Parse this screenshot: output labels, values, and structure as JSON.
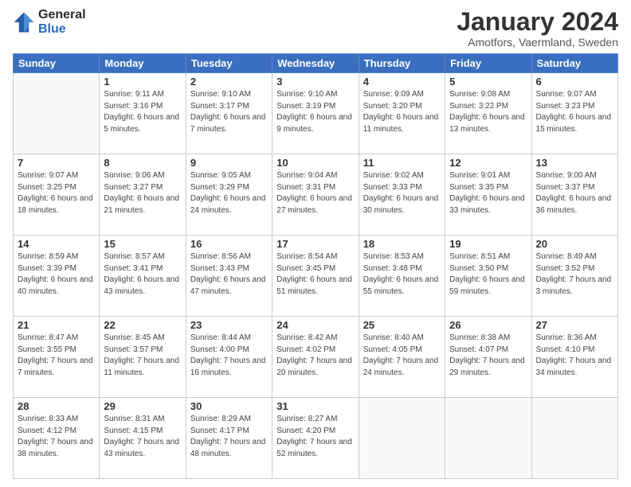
{
  "logo": {
    "line1": "General",
    "line2": "Blue"
  },
  "title": "January 2024",
  "subtitle": "Amotfors, Vaermland, Sweden",
  "days_of_week": [
    "Sunday",
    "Monday",
    "Tuesday",
    "Wednesday",
    "Thursday",
    "Friday",
    "Saturday"
  ],
  "weeks": [
    [
      {
        "day": "",
        "sunrise": "",
        "sunset": "",
        "daylight": ""
      },
      {
        "day": "1",
        "sunrise": "Sunrise: 9:11 AM",
        "sunset": "Sunset: 3:16 PM",
        "daylight": "Daylight: 6 hours and 5 minutes."
      },
      {
        "day": "2",
        "sunrise": "Sunrise: 9:10 AM",
        "sunset": "Sunset: 3:17 PM",
        "daylight": "Daylight: 6 hours and 7 minutes."
      },
      {
        "day": "3",
        "sunrise": "Sunrise: 9:10 AM",
        "sunset": "Sunset: 3:19 PM",
        "daylight": "Daylight: 6 hours and 9 minutes."
      },
      {
        "day": "4",
        "sunrise": "Sunrise: 9:09 AM",
        "sunset": "Sunset: 3:20 PM",
        "daylight": "Daylight: 6 hours and 11 minutes."
      },
      {
        "day": "5",
        "sunrise": "Sunrise: 9:08 AM",
        "sunset": "Sunset: 3:22 PM",
        "daylight": "Daylight: 6 hours and 13 minutes."
      },
      {
        "day": "6",
        "sunrise": "Sunrise: 9:07 AM",
        "sunset": "Sunset: 3:23 PM",
        "daylight": "Daylight: 6 hours and 15 minutes."
      }
    ],
    [
      {
        "day": "7",
        "sunrise": "Sunrise: 9:07 AM",
        "sunset": "Sunset: 3:25 PM",
        "daylight": "Daylight: 6 hours and 18 minutes."
      },
      {
        "day": "8",
        "sunrise": "Sunrise: 9:06 AM",
        "sunset": "Sunset: 3:27 PM",
        "daylight": "Daylight: 6 hours and 21 minutes."
      },
      {
        "day": "9",
        "sunrise": "Sunrise: 9:05 AM",
        "sunset": "Sunset: 3:29 PM",
        "daylight": "Daylight: 6 hours and 24 minutes."
      },
      {
        "day": "10",
        "sunrise": "Sunrise: 9:04 AM",
        "sunset": "Sunset: 3:31 PM",
        "daylight": "Daylight: 6 hours and 27 minutes."
      },
      {
        "day": "11",
        "sunrise": "Sunrise: 9:02 AM",
        "sunset": "Sunset: 3:33 PM",
        "daylight": "Daylight: 6 hours and 30 minutes."
      },
      {
        "day": "12",
        "sunrise": "Sunrise: 9:01 AM",
        "sunset": "Sunset: 3:35 PM",
        "daylight": "Daylight: 6 hours and 33 minutes."
      },
      {
        "day": "13",
        "sunrise": "Sunrise: 9:00 AM",
        "sunset": "Sunset: 3:37 PM",
        "daylight": "Daylight: 6 hours and 36 minutes."
      }
    ],
    [
      {
        "day": "14",
        "sunrise": "Sunrise: 8:59 AM",
        "sunset": "Sunset: 3:39 PM",
        "daylight": "Daylight: 6 hours and 40 minutes."
      },
      {
        "day": "15",
        "sunrise": "Sunrise: 8:57 AM",
        "sunset": "Sunset: 3:41 PM",
        "daylight": "Daylight: 6 hours and 43 minutes."
      },
      {
        "day": "16",
        "sunrise": "Sunrise: 8:56 AM",
        "sunset": "Sunset: 3:43 PM",
        "daylight": "Daylight: 6 hours and 47 minutes."
      },
      {
        "day": "17",
        "sunrise": "Sunrise: 8:54 AM",
        "sunset": "Sunset: 3:45 PM",
        "daylight": "Daylight: 6 hours and 51 minutes."
      },
      {
        "day": "18",
        "sunrise": "Sunrise: 8:53 AM",
        "sunset": "Sunset: 3:48 PM",
        "daylight": "Daylight: 6 hours and 55 minutes."
      },
      {
        "day": "19",
        "sunrise": "Sunrise: 8:51 AM",
        "sunset": "Sunset: 3:50 PM",
        "daylight": "Daylight: 6 hours and 59 minutes."
      },
      {
        "day": "20",
        "sunrise": "Sunrise: 8:49 AM",
        "sunset": "Sunset: 3:52 PM",
        "daylight": "Daylight: 7 hours and 3 minutes."
      }
    ],
    [
      {
        "day": "21",
        "sunrise": "Sunrise: 8:47 AM",
        "sunset": "Sunset: 3:55 PM",
        "daylight": "Daylight: 7 hours and 7 minutes."
      },
      {
        "day": "22",
        "sunrise": "Sunrise: 8:45 AM",
        "sunset": "Sunset: 3:57 PM",
        "daylight": "Daylight: 7 hours and 11 minutes."
      },
      {
        "day": "23",
        "sunrise": "Sunrise: 8:44 AM",
        "sunset": "Sunset: 4:00 PM",
        "daylight": "Daylight: 7 hours and 16 minutes."
      },
      {
        "day": "24",
        "sunrise": "Sunrise: 8:42 AM",
        "sunset": "Sunset: 4:02 PM",
        "daylight": "Daylight: 7 hours and 20 minutes."
      },
      {
        "day": "25",
        "sunrise": "Sunrise: 8:40 AM",
        "sunset": "Sunset: 4:05 PM",
        "daylight": "Daylight: 7 hours and 24 minutes."
      },
      {
        "day": "26",
        "sunrise": "Sunrise: 8:38 AM",
        "sunset": "Sunset: 4:07 PM",
        "daylight": "Daylight: 7 hours and 29 minutes."
      },
      {
        "day": "27",
        "sunrise": "Sunrise: 8:36 AM",
        "sunset": "Sunset: 4:10 PM",
        "daylight": "Daylight: 7 hours and 34 minutes."
      }
    ],
    [
      {
        "day": "28",
        "sunrise": "Sunrise: 8:33 AM",
        "sunset": "Sunset: 4:12 PM",
        "daylight": "Daylight: 7 hours and 38 minutes."
      },
      {
        "day": "29",
        "sunrise": "Sunrise: 8:31 AM",
        "sunset": "Sunset: 4:15 PM",
        "daylight": "Daylight: 7 hours and 43 minutes."
      },
      {
        "day": "30",
        "sunrise": "Sunrise: 8:29 AM",
        "sunset": "Sunset: 4:17 PM",
        "daylight": "Daylight: 7 hours and 48 minutes."
      },
      {
        "day": "31",
        "sunrise": "Sunrise: 8:27 AM",
        "sunset": "Sunset: 4:20 PM",
        "daylight": "Daylight: 7 hours and 52 minutes."
      },
      {
        "day": "",
        "sunrise": "",
        "sunset": "",
        "daylight": ""
      },
      {
        "day": "",
        "sunrise": "",
        "sunset": "",
        "daylight": ""
      },
      {
        "day": "",
        "sunrise": "",
        "sunset": "",
        "daylight": ""
      }
    ]
  ]
}
